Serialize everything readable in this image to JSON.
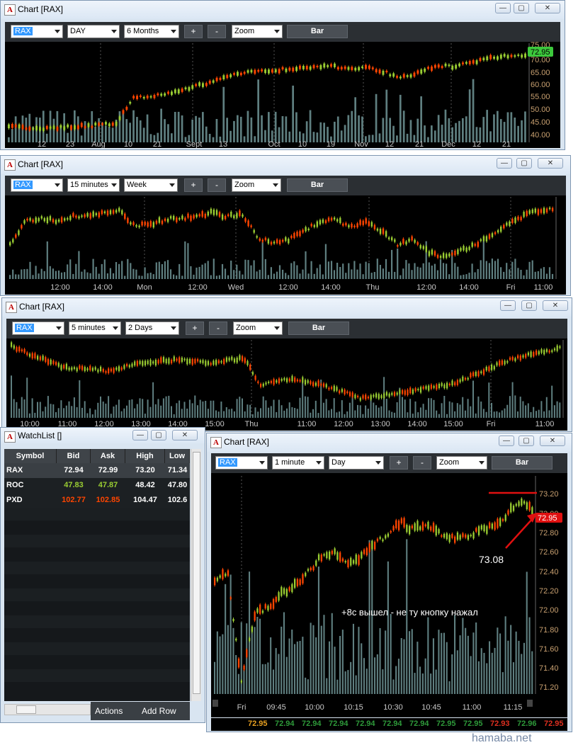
{
  "windows": [
    {
      "title": "Chart [RAX]",
      "symbol": "RAX",
      "interval": "DAY",
      "period": "6 Months",
      "plus": "+",
      "minus": "-",
      "zoom": "Zoom",
      "style": "Bar",
      "x_labels": [
        "12",
        "23",
        "Aug",
        "10",
        "21",
        "Sept",
        "13",
        "Oct",
        "10",
        "19",
        "Nov",
        "12",
        "21",
        "Dec",
        "12",
        "21"
      ],
      "y_labels": [
        "75.00",
        "70.00",
        "65.00",
        "60.00",
        "55.00",
        "50.00",
        "45.00",
        "40.00"
      ],
      "last_price": "72.95"
    },
    {
      "title": "Chart [RAX]",
      "symbol": "RAX",
      "interval": "15 minutes",
      "period": "Week",
      "plus": "+",
      "minus": "-",
      "zoom": "Zoom",
      "style": "Bar",
      "x_labels": [
        "12:00",
        "14:00",
        "Mon",
        "12:00",
        "Wed",
        "12:00",
        "14:00",
        "Thu",
        "12:00",
        "14:00",
        "Fri",
        "11:00"
      ]
    },
    {
      "title": "Chart [RAX]",
      "symbol": "RAX",
      "interval": "5 minutes",
      "period": "2 Days",
      "plus": "+",
      "minus": "-",
      "zoom": "Zoom",
      "style": "Bar",
      "x_labels": [
        "10:00",
        "11:00",
        "12:00",
        "13:00",
        "14:00",
        "15:00",
        "Thu",
        "11:00",
        "12:00",
        "13:00",
        "14:00",
        "15:00",
        "Fri",
        "11:00"
      ]
    },
    {
      "title": "Chart [RAX]",
      "symbol": "RAX",
      "interval": "1 minute",
      "period": "Day",
      "plus": "+",
      "minus": "-",
      "zoom": "Zoom",
      "style": "Bar",
      "x_labels": [
        "Fri",
        "09:45",
        "10:00",
        "10:15",
        "10:30",
        "10:45",
        "11:00",
        "11:15"
      ],
      "y_labels": [
        "73.20",
        "73.00",
        "72.80",
        "72.60",
        "72.40",
        "72.20",
        "72.00",
        "71.80",
        "71.60",
        "71.40",
        "71.20"
      ],
      "last_price": "72.95",
      "annotation_price": "73.08",
      "annotation_text": "+8c вышел - не ту кнопку нажал",
      "ticker": [
        {
          "v": "72.95",
          "c": "#e8a020"
        },
        {
          "v": "72.94",
          "c": "#2e9a3a"
        },
        {
          "v": "72.94",
          "c": "#2e9a3a"
        },
        {
          "v": "72.94",
          "c": "#2e9a3a"
        },
        {
          "v": "72.94",
          "c": "#2e9a3a"
        },
        {
          "v": "72.94",
          "c": "#2e9a3a"
        },
        {
          "v": "72.94",
          "c": "#2e9a3a"
        },
        {
          "v": "72.95",
          "c": "#2e9a3a"
        },
        {
          "v": "72.95",
          "c": "#2e9a3a"
        },
        {
          "v": "72.93",
          "c": "#e03020"
        },
        {
          "v": "72.96",
          "c": "#2e9a3a"
        },
        {
          "v": "72.95",
          "c": "#e03020"
        }
      ]
    }
  ],
  "watchlist": {
    "title": "WatchList []",
    "columns": [
      "Symbol",
      "Bid",
      "Ask",
      "High",
      "Low"
    ],
    "rows": [
      {
        "symbol": "RAX",
        "bid": "72.94",
        "ask": "72.99",
        "high": "73.20",
        "low": "71.34"
      },
      {
        "symbol": "ROC",
        "bid": "47.83",
        "ask": "47.87",
        "high": "48.42",
        "low": "47.80"
      },
      {
        "symbol": "PXD",
        "bid": "102.77",
        "ask": "102.85",
        "high": "104.47",
        "low": "102.6"
      }
    ],
    "actions": "Actions",
    "add_row": "Add Row"
  },
  "colors": {
    "up": "#9acd32",
    "down": "#ff4500",
    "bg": "#000000",
    "volume": "#5f7f80",
    "bid_up": "#9acd32",
    "bid_down": "#ff4500"
  },
  "watermark": "hamaba.net"
}
